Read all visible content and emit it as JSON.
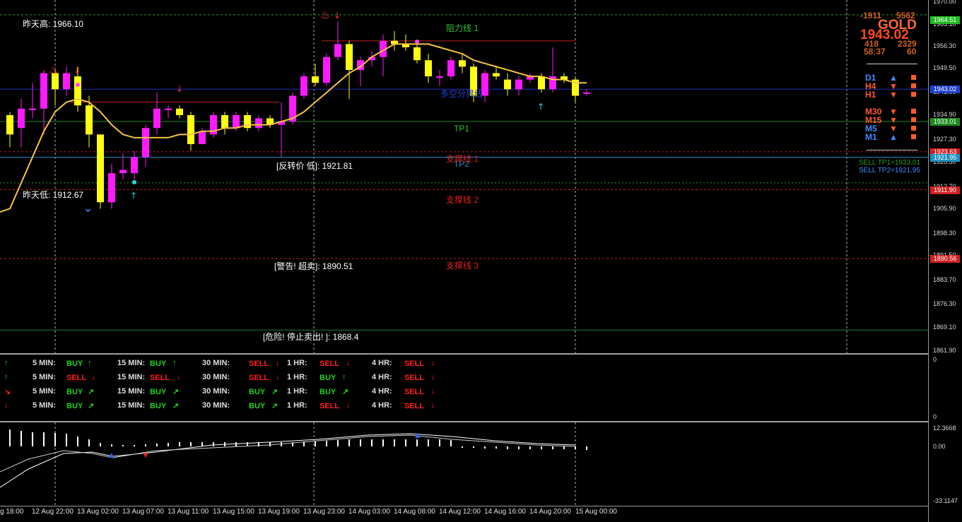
{
  "symbol": "GOLD",
  "price": "1943.02",
  "top_stats": {
    "a": "-1911",
    "b": "5562",
    "c": "418",
    "d": "2329",
    "time": "58:37",
    "e": "60"
  },
  "price_axis": [
    "1970.00",
    "1963.10",
    "1956.30",
    "1949.50",
    "1941.90",
    "1934.90",
    "1927.30",
    "1920.30",
    "1912.70",
    "1905.90",
    "1898.30",
    "1891.50",
    "1883.70",
    "1876.30",
    "1869.10",
    "1861.90"
  ],
  "price_axis_labels_visible": [
    "1970.00",
    "1963.10",
    "1956.30",
    "1949.50",
    "1941.90",
    "1934.90",
    "1927.30",
    "1920.30",
    "1912.70",
    "1905.90",
    "1898.30",
    "1891.50",
    "1883.70",
    "1876.30",
    "1869.10",
    "1861.90"
  ],
  "level_boxes": [
    {
      "text": "1964.51",
      "color": "#22bb22"
    },
    {
      "text": "1943.02",
      "color": "#2040d0"
    },
    {
      "text": "1933.01",
      "color": "#1f8a1f"
    },
    {
      "text": "1923.63",
      "color": "#d02020"
    },
    {
      "text": "1921.95",
      "color": "#1e90c0"
    },
    {
      "text": "1911.90",
      "color": "#d02020"
    },
    {
      "text": "1890.56",
      "color": "#d02020"
    }
  ],
  "chart_labels": {
    "yesterday_high": "昨天高: 1966.10",
    "yesterday_low": "昨天低: 1912.67",
    "resist1": "阻力线 1",
    "tp1": "TP1",
    "tp2": "TP2",
    "support1": "支撑线 1",
    "support2": "支撑线 2",
    "support3": "支撑线 3",
    "reverse_low": "[反转价 低]: 1921.81",
    "warn_oversold": "[警告! 超卖]: 1890.51",
    "danger_stop": "[危险! 停止卖出! ]: 1868.4",
    "trend_label": "多空分界线"
  },
  "sell_tp": [
    "SELL TP1=1933.01",
    "SELL TP2=1921.95"
  ],
  "timeframes": [
    {
      "tf": "D1",
      "color": "#3d8bff",
      "arrow": "▲",
      "acolor": "#3d8bff"
    },
    {
      "tf": "H4",
      "color": "#ff5a28",
      "arrow": "▼",
      "acolor": "#ff5a28"
    },
    {
      "tf": "H1",
      "color": "#ff5a28",
      "arrow": "▼",
      "acolor": "#ff5a28"
    },
    {
      "tf": "M30",
      "color": "#ff5a28",
      "arrow": "▼",
      "acolor": "#ff5a28"
    },
    {
      "tf": "M15",
      "color": "#ff5a28",
      "arrow": "▼",
      "acolor": "#ff5a28"
    },
    {
      "tf": "M5",
      "color": "#3d8bff",
      "arrow": "▼",
      "acolor": "#ff5a28"
    },
    {
      "tf": "M1",
      "color": "#3d8bff",
      "arrow": "▲",
      "acolor": "#3d8bff"
    }
  ],
  "signal_rows": [
    {
      "arrow": "↑",
      "acolor": "#1fd21f",
      "cells": [
        [
          "5 MIN:",
          "BUY",
          "↑"
        ],
        [
          "15 MIN:",
          "BUY",
          "↑"
        ],
        [
          "30 MIN:",
          "SELL",
          "↓"
        ],
        [
          "1 HR:",
          "SELL",
          "↓"
        ],
        [
          "4 HR:",
          "SELL",
          "↓"
        ]
      ]
    },
    {
      "arrow": "↑",
      "acolor": "#1fd21f",
      "cells": [
        [
          "5 MIN:",
          "SELL",
          "↓"
        ],
        [
          "15 MIN:",
          "SELL",
          "↓"
        ],
        [
          "30 MIN:",
          "SELL",
          "↓"
        ],
        [
          "1 HR:",
          "BUY",
          "↑"
        ],
        [
          "4 HR:",
          "SELL",
          "↓"
        ]
      ]
    },
    {
      "arrow": "↘",
      "acolor": "#ff2020",
      "cells": [
        [
          "5 MIN:",
          "BUY",
          "↗"
        ],
        [
          "15 MIN:",
          "BUY",
          "↗"
        ],
        [
          "30 MIN:",
          "BUY",
          "↗"
        ],
        [
          "1 HR:",
          "BUY",
          "↗"
        ],
        [
          "4 HR:",
          "SELL",
          "↓"
        ]
      ]
    },
    {
      "arrow": "↓",
      "acolor": "#ff2020",
      "cells": [
        [
          "5 MIN:",
          "BUY",
          "↗"
        ],
        [
          "15 MIN:",
          "BUY",
          "↗"
        ],
        [
          "30 MIN:",
          "BUY",
          "↗"
        ],
        [
          "1 HR:",
          "SELL",
          "↓"
        ],
        [
          "4 HR:",
          "SELL",
          "↓"
        ]
      ]
    }
  ],
  "signal_axis": [
    "0",
    "0"
  ],
  "osc_axis": [
    "12.3668",
    "0.00",
    "-33.1147"
  ],
  "time_axis": [
    "g 18:00",
    "12 Aug 22:00",
    "13 Aug 02:00",
    "13 Aug 07:00",
    "13 Aug 11:00",
    "13 Aug 15:00",
    "13 Aug 19:00",
    "13 Aug 23:00",
    "14 Aug 03:00",
    "14 Aug 08:00",
    "14 Aug 12:00",
    "14 Aug 16:00",
    "14 Aug 20:00",
    "15 Aug 00:00"
  ],
  "candles": [
    {
      "o": 1935,
      "c": 1929,
      "h": 1936,
      "l": 1925
    },
    {
      "o": 1931,
      "c": 1937,
      "h": 1940,
      "l": 1925
    },
    {
      "o": 1937,
      "c": 1937,
      "h": 1945,
      "l": 1934
    },
    {
      "o": 1937,
      "c": 1948,
      "h": 1949,
      "l": 1929
    },
    {
      "o": 1948,
      "c": 1943,
      "h": 1949,
      "l": 1938
    },
    {
      "o": 1943,
      "c": 1948,
      "h": 1950,
      "l": 1941
    },
    {
      "o": 1947,
      "c": 1938,
      "h": 1950,
      "l": 1936
    },
    {
      "o": 1938,
      "c": 1929,
      "h": 1941,
      "l": 1925
    },
    {
      "o": 1929,
      "c": 1908,
      "h": 1929,
      "l": 1906
    },
    {
      "o": 1908,
      "c": 1917,
      "h": 1920,
      "l": 1906
    },
    {
      "o": 1917,
      "c": 1918,
      "h": 1923,
      "l": 1915
    },
    {
      "o": 1917,
      "c": 1922,
      "h": 1924,
      "l": 1915
    },
    {
      "o": 1922,
      "c": 1931,
      "h": 1932,
      "l": 1919
    },
    {
      "o": 1931,
      "c": 1937,
      "h": 1942,
      "l": 1929
    },
    {
      "o": 1937,
      "c": 1937,
      "h": 1938,
      "l": 1934
    },
    {
      "o": 1937,
      "c": 1935,
      "h": 1938,
      "l": 1934
    },
    {
      "o": 1935,
      "c": 1926,
      "h": 1936,
      "l": 1924
    },
    {
      "o": 1926,
      "c": 1930,
      "h": 1931,
      "l": 1926
    },
    {
      "o": 1929,
      "c": 1935,
      "h": 1936,
      "l": 1928
    },
    {
      "o": 1935,
      "c": 1931,
      "h": 1936,
      "l": 1929
    },
    {
      "o": 1931,
      "c": 1935,
      "h": 1936,
      "l": 1930
    },
    {
      "o": 1935,
      "c": 1931,
      "h": 1936,
      "l": 1930
    },
    {
      "o": 1931,
      "c": 1934,
      "h": 1935,
      "l": 1930
    },
    {
      "o": 1934,
      "c": 1932,
      "h": 1935,
      "l": 1931
    },
    {
      "o": 1932,
      "c": 1933,
      "h": 1939,
      "l": 1922
    },
    {
      "o": 1933,
      "c": 1941,
      "h": 1942,
      "l": 1932
    },
    {
      "o": 1941,
      "c": 1947,
      "h": 1948,
      "l": 1940
    },
    {
      "o": 1947,
      "c": 1945,
      "h": 1951,
      "l": 1944
    },
    {
      "o": 1945,
      "c": 1953,
      "h": 1954,
      "l": 1944
    },
    {
      "o": 1953,
      "c": 1957,
      "h": 1964,
      "l": 1952
    },
    {
      "o": 1957,
      "c": 1949,
      "h": 1958,
      "l": 1940
    },
    {
      "o": 1949,
      "c": 1952,
      "h": 1953,
      "l": 1944
    },
    {
      "o": 1952,
      "c": 1953,
      "h": 1955,
      "l": 1950
    },
    {
      "o": 1953,
      "c": 1958,
      "h": 1960,
      "l": 1947
    },
    {
      "o": 1958,
      "c": 1957,
      "h": 1961,
      "l": 1955
    },
    {
      "o": 1957,
      "c": 1956,
      "h": 1960,
      "l": 1955
    },
    {
      "o": 1956,
      "c": 1952,
      "h": 1958,
      "l": 1951
    },
    {
      "o": 1952,
      "c": 1947,
      "h": 1954,
      "l": 1945
    },
    {
      "o": 1947,
      "c": 1947,
      "h": 1949,
      "l": 1944
    },
    {
      "o": 1947,
      "c": 1952,
      "h": 1953,
      "l": 1946
    },
    {
      "o": 1952,
      "c": 1950,
      "h": 1954,
      "l": 1948
    },
    {
      "o": 1950,
      "c": 1941,
      "h": 1951,
      "l": 1939
    },
    {
      "o": 1941,
      "c": 1948,
      "h": 1949,
      "l": 1939
    },
    {
      "o": 1948,
      "c": 1947,
      "h": 1950,
      "l": 1946
    },
    {
      "o": 1946,
      "c": 1943,
      "h": 1948,
      "l": 1941
    },
    {
      "o": 1943,
      "c": 1946,
      "h": 1947,
      "l": 1941
    },
    {
      "o": 1946,
      "c": 1947,
      "h": 1948,
      "l": 1945
    },
    {
      "o": 1947,
      "c": 1943,
      "h": 1948,
      "l": 1942
    },
    {
      "o": 1943,
      "c": 1947,
      "h": 1956,
      "l": 1942
    },
    {
      "o": 1947,
      "c": 1946,
      "h": 1948,
      "l": 1945
    },
    {
      "o": 1946,
      "c": 1941,
      "h": 1947,
      "l": 1939
    },
    {
      "o": 1942,
      "c": 1942,
      "h": 1943,
      "l": 1941
    }
  ]
}
